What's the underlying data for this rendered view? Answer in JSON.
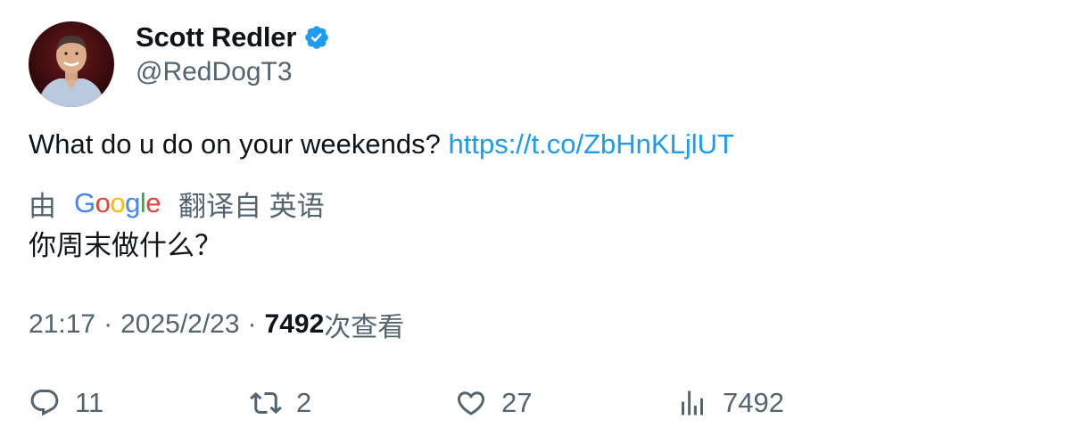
{
  "author": {
    "display_name": "Scott Redler",
    "handle": "@RedDogT3",
    "verified": true,
    "verified_color": "#1d9bf0"
  },
  "tweet": {
    "text": "What do u do on your weekends?",
    "link": "https://t.co/ZbHnKLjlUT",
    "link_color": "#1d9bf0"
  },
  "translation": {
    "prefix": "由",
    "provider_letters": [
      {
        "char": "G",
        "color": "#4285F4"
      },
      {
        "char": "o",
        "color": "#EA4335"
      },
      {
        "char": "o",
        "color": "#FBBC05"
      },
      {
        "char": "g",
        "color": "#4285F4"
      },
      {
        "char": "l",
        "color": "#34A853"
      },
      {
        "char": "e",
        "color": "#EA4335"
      }
    ],
    "suffix": "翻译自 英语",
    "translated_text": "你周末做什么？"
  },
  "meta": {
    "time": "21:17",
    "separator": "·",
    "date": "2025/2/23",
    "views_count": "7492",
    "views_label": "次查看"
  },
  "actions": {
    "reply": {
      "icon": "reply-icon",
      "count": "11"
    },
    "retweet": {
      "icon": "retweet-icon",
      "count": "2"
    },
    "like": {
      "icon": "heart-icon",
      "count": "27"
    },
    "views": {
      "icon": "bar-chart-icon",
      "count": "7492"
    }
  },
  "colors": {
    "text_primary": "#0f1419",
    "text_secondary": "#536471"
  }
}
